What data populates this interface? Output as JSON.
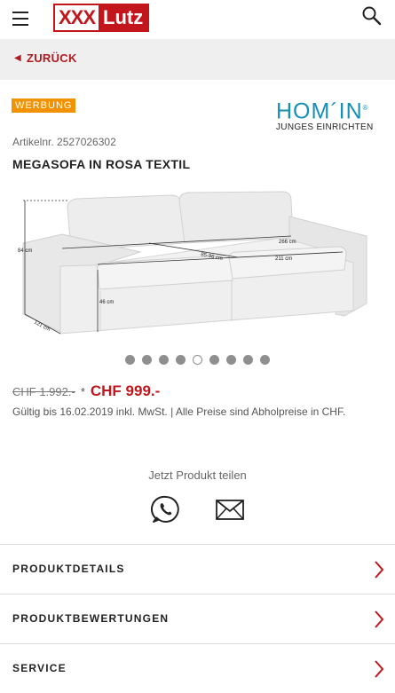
{
  "header": {
    "logo_left": "XXX",
    "logo_right": "Lutz"
  },
  "back": {
    "label": "ZURÜCK"
  },
  "ad_badge": "WERBUNG",
  "brand": {
    "name": "HOM´IN",
    "registered": "®",
    "tagline": "JUNGES EINRICHTEN"
  },
  "product": {
    "article_number": "Artikelnr. 2527026302",
    "title": "MEGASOFA IN ROSA TEXTIL",
    "dimensions": {
      "height": "84 cm",
      "depth": "121 cm",
      "seat_depth": "85-96 cm",
      "width_total": "266 cm",
      "seat_width": "211 cm",
      "seat_height": "46 cm"
    }
  },
  "gallery": {
    "count": 9,
    "active_index": 4
  },
  "pricing": {
    "old_price": "CHF 1.992.-",
    "asterisk": "*",
    "new_price": "CHF 999.-",
    "validity": "Gültig bis 16.02.2019 inkl. MwSt. | Alle Preise sind Abholpreise in CHF."
  },
  "share": {
    "label": "Jetzt Produkt teilen",
    "icons": [
      "whatsapp-icon",
      "mail-icon"
    ]
  },
  "accordion": [
    {
      "label": "PRODUKTDETAILS"
    },
    {
      "label": "PRODUKTBEWERTUNGEN"
    },
    {
      "label": "SERVICE"
    }
  ],
  "colors": {
    "brand_red": "#c3161c",
    "ad_orange": "#f39200",
    "brand_blue": "#1690b5"
  }
}
